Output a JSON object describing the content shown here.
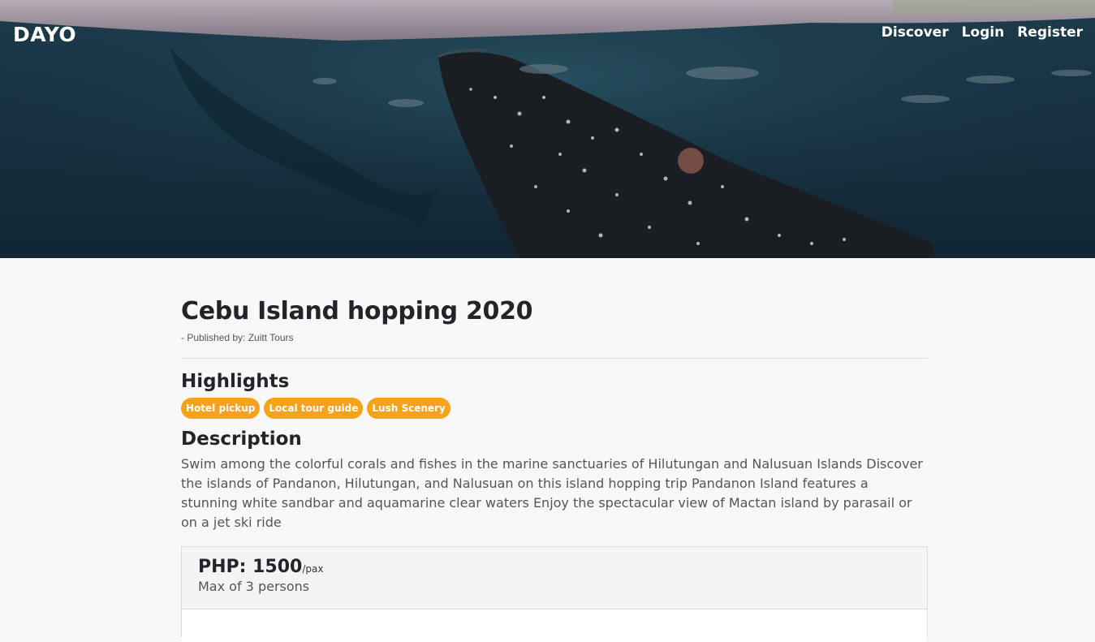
{
  "nav": {
    "brand": "DAYO",
    "links": [
      "Discover",
      "Login",
      "Register"
    ]
  },
  "tour": {
    "title": "Cebu Island hopping 2020",
    "publisher": "- Published by: Zuitt Tours",
    "highlights_heading": "Highlights",
    "highlights": [
      "Hotel pickup",
      "Local tour guide",
      "Lush Scenery"
    ],
    "description_heading": "Description",
    "description": "Swim among the colorful corals and fishes in the marine sanctuaries of Hilutungan and Nalusuan Islands Discover the islands of Pandanon, Hilutungan, and Nalusuan on this island hopping trip Pandanon Island features a stunning white sandbar and aquamarine clear waters Enjoy the spectacular view of Mactan island by parasail or on a jet ski ride",
    "price_label": "PHP: 1500",
    "price_unit": "/pax",
    "capacity": "Max of 3 persons"
  },
  "colors": {
    "badge": "#f7a31a",
    "background": "#f8f8f8",
    "text": "#212529"
  },
  "hero": {
    "image_subject": "whale-shark-underwater"
  }
}
